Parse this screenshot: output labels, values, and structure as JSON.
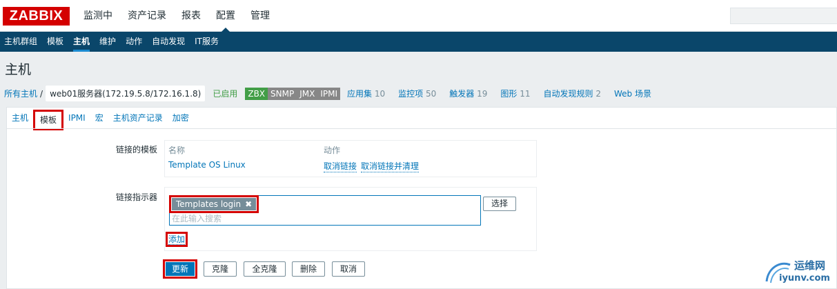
{
  "header": {
    "logo": "ZABBIX",
    "menu": [
      {
        "label": "监测中"
      },
      {
        "label": "资产记录"
      },
      {
        "label": "报表"
      },
      {
        "label": "配置",
        "active": true
      },
      {
        "label": "管理"
      }
    ]
  },
  "submenu": [
    {
      "label": "主机群组"
    },
    {
      "label": "模板"
    },
    {
      "label": "主机",
      "active": true
    },
    {
      "label": "维护"
    },
    {
      "label": "动作"
    },
    {
      "label": "自动发现"
    },
    {
      "label": "IT服务"
    }
  ],
  "page_title": "主机",
  "breadcrumb": {
    "all_hosts": "所有主机",
    "separator": "/",
    "host": "web01服务器(172.19.5.8/172.16.1.8)",
    "status": "已启用",
    "badges": [
      {
        "label": "ZBX",
        "color": "#429e47"
      },
      {
        "label": "SNMP",
        "color": "#878787"
      },
      {
        "label": "JMX",
        "color": "#878787"
      },
      {
        "label": "IPMI",
        "color": "#878787"
      }
    ],
    "stats": [
      {
        "label": "应用集",
        "count": "10"
      },
      {
        "label": "监控项",
        "count": "50"
      },
      {
        "label": "触发器",
        "count": "19"
      },
      {
        "label": "图形",
        "count": "11"
      },
      {
        "label": "自动发现规则",
        "count": "2"
      },
      {
        "label": "Web 场景",
        "count": ""
      }
    ]
  },
  "tabs": [
    {
      "label": "主机"
    },
    {
      "label": "模板",
      "active": true
    },
    {
      "label": "IPMI"
    },
    {
      "label": "宏"
    },
    {
      "label": "主机资产记录"
    },
    {
      "label": "加密"
    }
  ],
  "form": {
    "linked_label": "链接的模板",
    "col_name": "名称",
    "col_action": "动作",
    "template_name": "Template OS Linux",
    "unlink": "取消链接",
    "unlink_clear": "取消链接并清理",
    "link_label": "链接指示器",
    "chip": "Templates login",
    "chip_remove": "✖",
    "placeholder": "在此输入搜索",
    "select_button": "选择",
    "add_link": "添加"
  },
  "buttons": {
    "update": "更新",
    "clone": "克隆",
    "full_clone": "全克隆",
    "delete": "删除",
    "cancel": "取消"
  },
  "watermark": {
    "line1": "运维网",
    "line2": "iyunv.com"
  }
}
